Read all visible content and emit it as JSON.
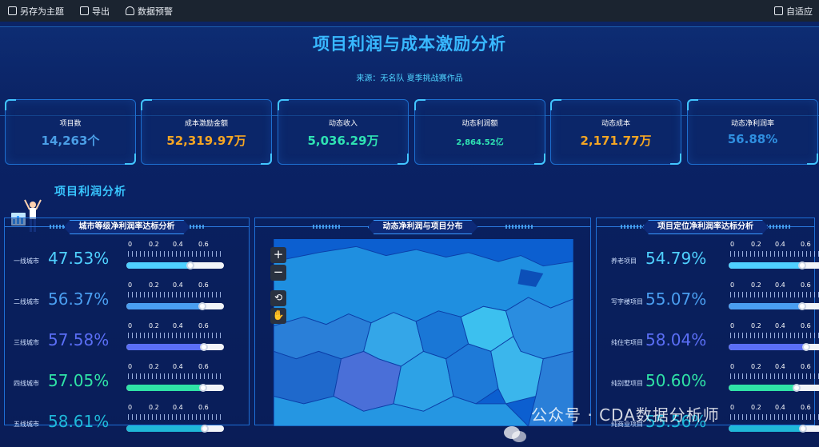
{
  "toolbar": {
    "save_theme": "另存为主题",
    "export": "导出",
    "data_alert": "数据预警",
    "adaptive": "自适应"
  },
  "header": {
    "title": "项目利润与成本激励分析",
    "subtitle": "来源：无名队 夏季挑战赛作品"
  },
  "kpis": [
    {
      "label": "项目数",
      "value": "14,263个",
      "color": "#4a9ee6"
    },
    {
      "label": "成本激励金额",
      "value": "52,319.97万",
      "color": "#f6a623"
    },
    {
      "label": "动态收入",
      "value": "5,036.29万",
      "color": "#2fe3b3"
    },
    {
      "label": "动态利润额",
      "value": "2,864.52亿",
      "color": "#2fe3b3"
    },
    {
      "label": "动态成本",
      "value": "2,171.77万",
      "color": "#f6a623"
    },
    {
      "label": "动态净利润率",
      "value": "56.88%",
      "color": "#2f8fe0"
    }
  ],
  "section_title": "项目利润分析",
  "scale_labels": [
    "0",
    "0.2",
    "0.4",
    "0.6"
  ],
  "left_panel": {
    "title": "城市等级净利润率达标分析",
    "rows": [
      {
        "label": "一线城市",
        "value": "47.53%",
        "fraction": 0.4753,
        "color": "#4fd0ff"
      },
      {
        "label": "二线城市",
        "value": "56.37%",
        "fraction": 0.5637,
        "color": "#4a9ef0"
      },
      {
        "label": "三线城市",
        "value": "57.58%",
        "fraction": 0.5758,
        "color": "#5a6ef5"
      },
      {
        "label": "四线城市",
        "value": "57.05%",
        "fraction": 0.5705,
        "color": "#2fe3a6"
      },
      {
        "label": "五线城市",
        "value": "58.61%",
        "fraction": 0.5861,
        "color": "#1fb8d8"
      }
    ]
  },
  "map_panel": {
    "title": "动态净利润与项目分布",
    "zoom_in": "+",
    "zoom_out": "−"
  },
  "right_panel": {
    "title": "项目定位净利润率达标分析",
    "rows": [
      {
        "label": "养老项目",
        "value": "54.79%",
        "fraction": 0.5479,
        "color": "#4fd0ff"
      },
      {
        "label": "写字楼项目",
        "value": "55.07%",
        "fraction": 0.5507,
        "color": "#4a9ef0"
      },
      {
        "label": "纯住宅项目",
        "value": "58.04%",
        "fraction": 0.5804,
        "color": "#5a6ef5"
      },
      {
        "label": "纯别墅项目",
        "value": "50.60%",
        "fraction": 0.506,
        "color": "#2fe3a6"
      },
      {
        "label": "纯商业项目",
        "value": "55.56%",
        "fraction": 0.5556,
        "color": "#1fb8d8"
      }
    ]
  },
  "watermark": "公众号 · CDA数据分析师"
}
